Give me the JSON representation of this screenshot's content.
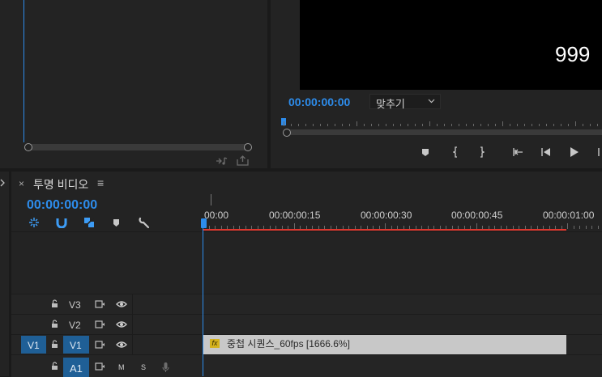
{
  "program_monitor": {
    "overlay_number": "999",
    "timecode": "00:00:00:00",
    "fit_label": "맞추기",
    "transport_icons": [
      "marker-icon",
      "mark-in-icon",
      "mark-out-icon",
      "go-to-in-icon",
      "step-back-icon",
      "play-icon",
      "step-forward-icon"
    ]
  },
  "timeline": {
    "close_label": "×",
    "sequence_name": "투명 비디오",
    "menu_label": "≡",
    "timecode": "00:00:00:00",
    "ruler_labels": [
      "00:00",
      "00:00:00:15",
      "00:00:00:30",
      "00:00:00:45",
      "00:00:01:00"
    ],
    "tracks": [
      {
        "source": "",
        "name": "V3"
      },
      {
        "source": "",
        "name": "V2"
      },
      {
        "source": "V1",
        "name": "V1"
      },
      {
        "source": "",
        "name": "A1",
        "m": "M",
        "s": "S"
      }
    ],
    "clip": {
      "fx": "fx",
      "label": "중첩 시퀀스_60fps [1666.6%]"
    }
  },
  "colors": {
    "accent": "#2d8ceb",
    "work_area": "#e0372e",
    "clip": "#c8c8c8"
  }
}
